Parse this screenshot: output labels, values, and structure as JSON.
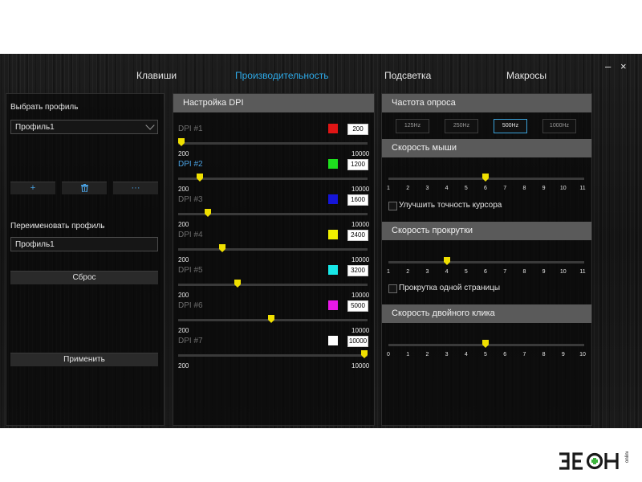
{
  "window": {
    "minimize": "–",
    "close": "×"
  },
  "tabs": [
    {
      "label": "Клавиши",
      "active": false
    },
    {
      "label": "Производительность",
      "active": true
    },
    {
      "label": "Подсветка",
      "active": false
    },
    {
      "label": "Макросы",
      "active": false
    }
  ],
  "profile": {
    "select_label": "Выбрать профиль",
    "selected": "Профиль1",
    "add_icon": "plus-icon",
    "add_glyph": "+",
    "delete_icon": "trash-icon",
    "delete_glyph": "🗑",
    "more_icon": "more-icon",
    "more_glyph": "···",
    "rename_label": "Переименовать профиль",
    "rename_value": "Профиль1",
    "reset": "Сброс",
    "apply": "Применить"
  },
  "dpi": {
    "title": "Настройка DPI",
    "min": "200",
    "max": "10000",
    "rows": [
      {
        "label": "DPI #1",
        "value": "200",
        "color": "#e01515",
        "active": false,
        "level": 0.0
      },
      {
        "label": "DPI #2",
        "value": "1200",
        "color": "#1ee01e",
        "active": true,
        "level": 0.102
      },
      {
        "label": "DPI #3",
        "value": "1600",
        "color": "#1515d8",
        "active": false,
        "level": 0.143
      },
      {
        "label": "DPI #4",
        "value": "2400",
        "color": "#f0f000",
        "active": false,
        "level": 0.224
      },
      {
        "label": "DPI #5",
        "value": "3200",
        "color": "#18e8e8",
        "active": false,
        "level": 0.306
      },
      {
        "label": "DPI #6",
        "value": "5000",
        "color": "#e818e8",
        "active": false,
        "level": 0.49
      },
      {
        "label": "DPI #7",
        "value": "10000",
        "color": "#ffffff",
        "active": false,
        "level": 1.0
      }
    ]
  },
  "polling": {
    "title": "Частота опроса",
    "rates": [
      {
        "label": "125Hz",
        "selected": false
      },
      {
        "label": "250Hz",
        "selected": false
      },
      {
        "label": "500Hz",
        "selected": true
      },
      {
        "label": "1000Hz",
        "selected": false
      }
    ]
  },
  "mouse_speed": {
    "title": "Скорость мыши",
    "ticks": [
      "1",
      "2",
      "3",
      "4",
      "5",
      "6",
      "7",
      "8",
      "9",
      "10",
      "11"
    ],
    "value": 6,
    "checkbox_label": "Улучшить точность курсора"
  },
  "scroll_speed": {
    "title": "Скорость прокрутки",
    "ticks": [
      "1",
      "2",
      "3",
      "4",
      "5",
      "6",
      "7",
      "8",
      "9",
      "10",
      "11"
    ],
    "value": 4,
    "checkbox_label": "Прокрутка одной страницы"
  },
  "double_click": {
    "title": "Скорость двойного клика",
    "ticks": [
      "0",
      "1",
      "2",
      "3",
      "4",
      "5",
      "6",
      "7",
      "8",
      "9",
      "10"
    ],
    "value": 5
  },
  "watermark": {
    "text": "ЗЕОН",
    "sub": "onlinе"
  }
}
